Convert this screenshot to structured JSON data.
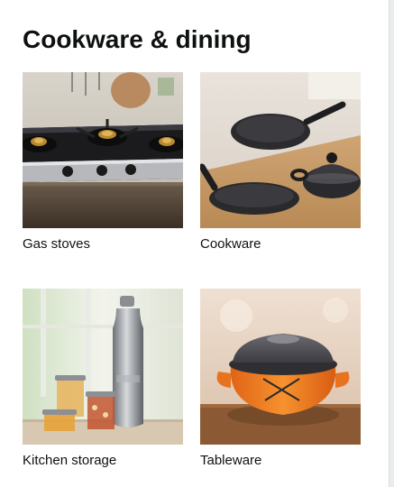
{
  "card": {
    "title": "Cookware & dining",
    "tiles": [
      {
        "label": "Gas stoves"
      },
      {
        "label": "Cookware"
      },
      {
        "label": "Kitchen storage"
      },
      {
        "label": "Tableware"
      }
    ]
  },
  "colors": {
    "text": "#0f1111",
    "card_background": "#ffffff",
    "page_background": "#e3e6e6",
    "accent_orange": "#f07a1c"
  },
  "icons": {
    "tile_1": "gas-stove-image",
    "tile_2": "cookware-pans-image",
    "tile_3": "kitchen-storage-jars-image",
    "tile_4": "tableware-casserole-image"
  }
}
